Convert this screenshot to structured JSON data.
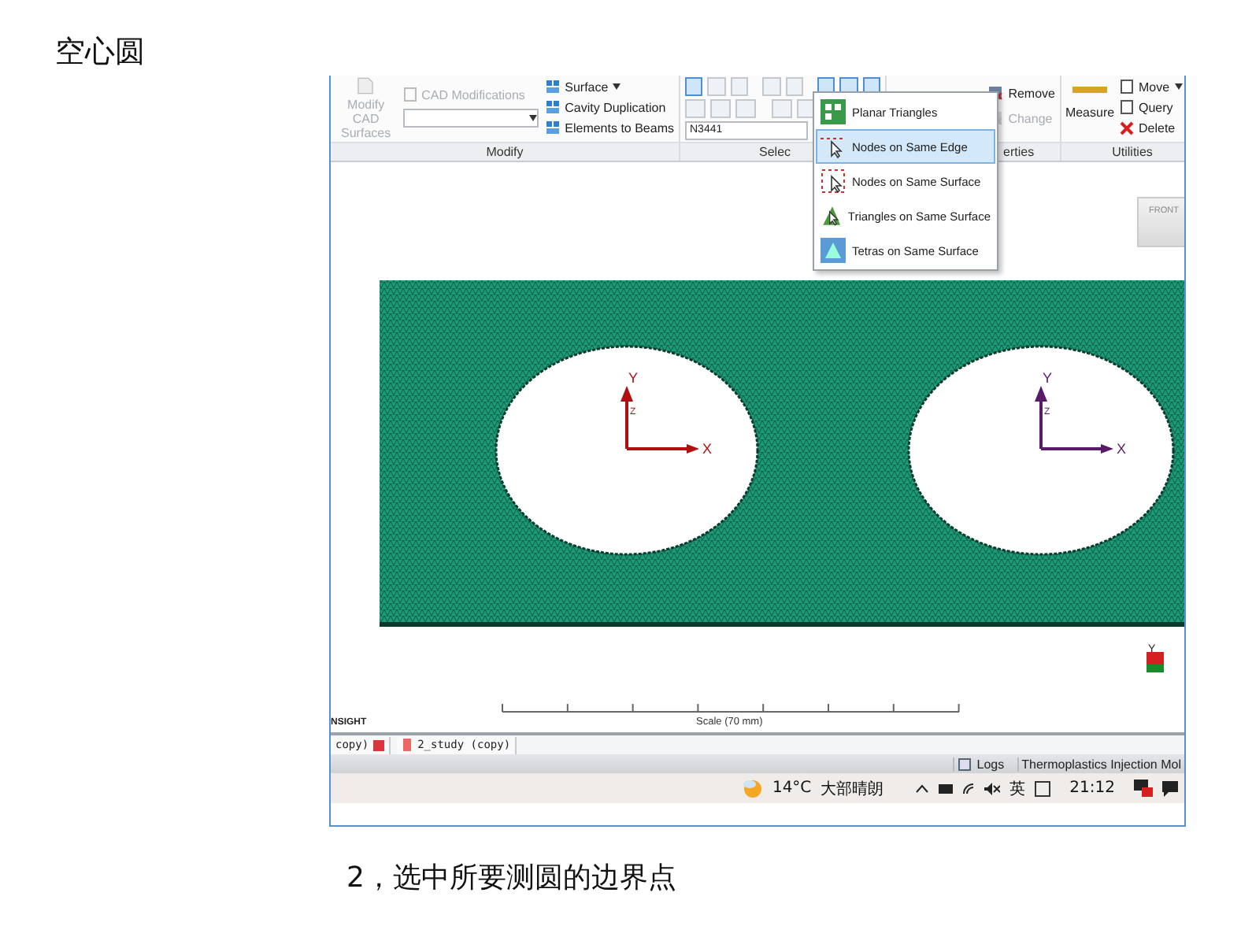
{
  "heading": "空心圆",
  "app": {
    "ribbon": {
      "groups": [
        {
          "kind": "modify",
          "label": "Modify",
          "large": {
            "label": "Modify CAD Surfaces",
            "disabled": true
          },
          "command": {
            "label": "CAD Modifications",
            "disabled": true
          },
          "tools": [
            {
              "label": "Surface",
              "dropdown": true
            },
            {
              "label": "Cavity Duplication",
              "dropdown": false
            },
            {
              "label": "Elements to Beams",
              "dropdown": false
            }
          ]
        },
        {
          "kind": "select",
          "label": "Selec",
          "field": "N3441"
        },
        {
          "kind": "properties",
          "label": "erties",
          "tools": [
            {
              "label": "Remove",
              "disabled": false
            },
            {
              "label": "Change",
              "disabled": true
            }
          ]
        },
        {
          "kind": "utilities",
          "label": "Utilities",
          "large": {
            "label": "Measure"
          },
          "tools": [
            {
              "label": "Move",
              "dropdown": true
            },
            {
              "label": "Query",
              "dropdown": false
            },
            {
              "label": "Delete",
              "dropdown": false
            }
          ]
        }
      ]
    },
    "menu": [
      {
        "label": "Planar Triangles",
        "selected": false
      },
      {
        "label": "Nodes on Same Edge",
        "selected": true
      },
      {
        "label": "Nodes on Same Surface",
        "selected": false
      },
      {
        "label": "Triangles on Same Surface",
        "selected": false
      },
      {
        "label": "Tetras on Same Surface",
        "selected": false
      }
    ],
    "viewport": {
      "view_cube": "FRONT",
      "triads": [
        {
          "y": "Y",
          "z": "Z",
          "x": "X",
          "color": "#b01010"
        },
        {
          "y": "Y",
          "z": "Z",
          "x": "X",
          "color": "#5a1a6a"
        }
      ],
      "corner_axis": "Y",
      "scale": "Scale (70 mm)",
      "product": "NSIGHT"
    },
    "tabs": [
      {
        "label": "copy)",
        "closable": true
      },
      {
        "label": "2_study (copy)",
        "closable": false
      }
    ],
    "status": [
      "Logs",
      "Thermoplastics Injection Mol"
    ],
    "taskbar": {
      "temperature": "14°C",
      "weather": "大部晴朗",
      "ime": "英",
      "time": "21:12"
    }
  },
  "caption": "2，选中所要测圆的边界点"
}
